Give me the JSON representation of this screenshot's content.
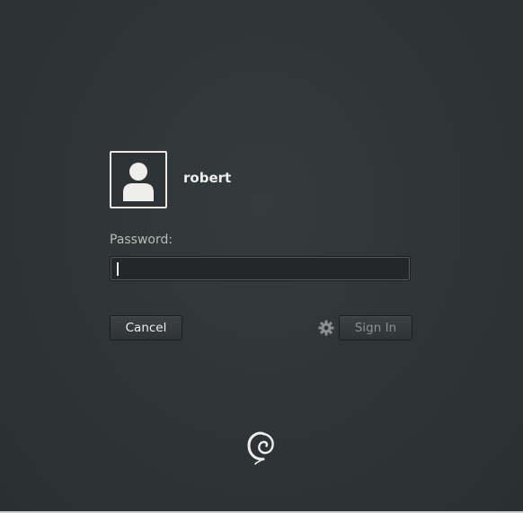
{
  "user": {
    "name": "robert",
    "avatar_icon": "user-avatar-icon"
  },
  "password": {
    "label": "Password:",
    "value": ""
  },
  "buttons": {
    "cancel_label": "Cancel",
    "signin_label": "Sign In"
  },
  "icons": {
    "settings": "gear-icon",
    "distro_logo": "debian-swirl-icon"
  },
  "colors": {
    "background": "#2e3436",
    "text": "#eeeeec",
    "muted_text": "#babdb6",
    "disabled_text": "#8b8f8f"
  }
}
